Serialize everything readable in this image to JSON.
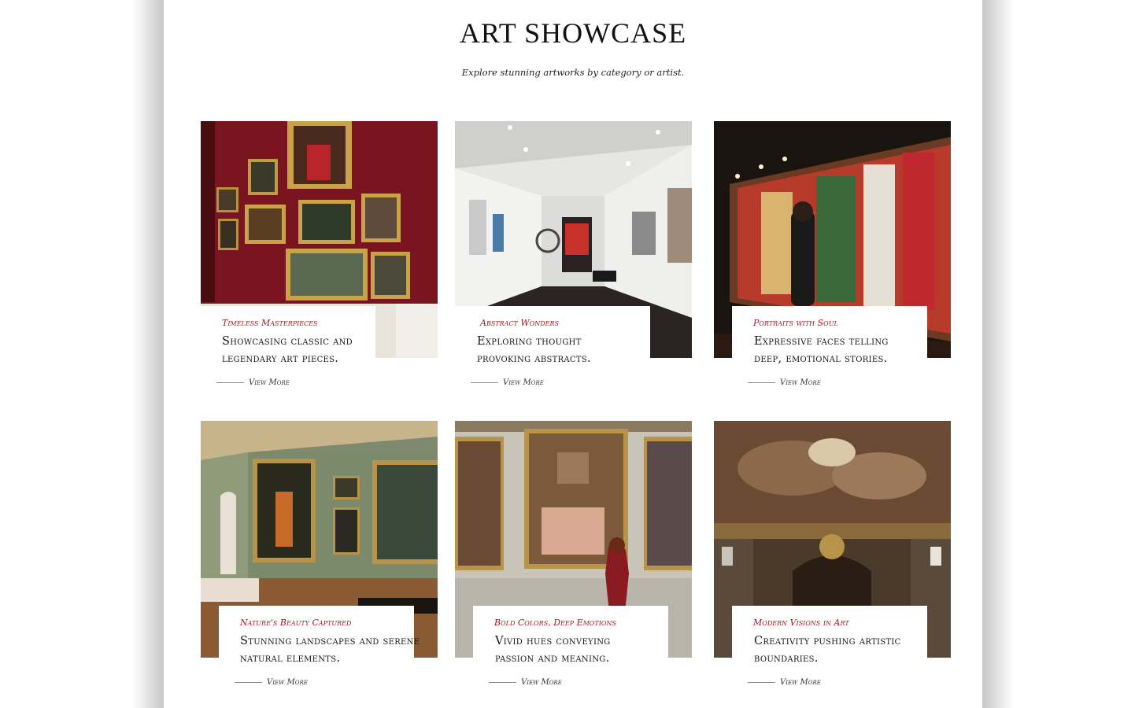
{
  "header": {
    "title": "ART SHOWCASE",
    "subtitle": "Explore stunning artworks by category or artist."
  },
  "cards": [
    {
      "category": "Timeless Masterpieces",
      "description": "Showcasing classic and legendary art pieces.",
      "link": "View More"
    },
    {
      "category": "Abstract Wonders",
      "description": "Exploring thought provoking abstracts.",
      "link": "View More"
    },
    {
      "category": "Portraits with Soul",
      "description": "Expressive faces telling deep, emotional stories.",
      "link": "View More"
    },
    {
      "category": "Nature's Beauty Captured",
      "description": "Stunning landscapes and serene natural elements.",
      "link": "View More"
    },
    {
      "category": "Bold Colors, Deep Emotions",
      "description": "Vivid hues conveying passion and meaning.",
      "link": "View More"
    },
    {
      "category": "Modern Visions in Art",
      "description": "Creativity pushing artistic boundaries.",
      "link": "View More"
    }
  ],
  "colors": {
    "accent": "#a31a22",
    "text": "#161616",
    "background": "#ffffff"
  }
}
